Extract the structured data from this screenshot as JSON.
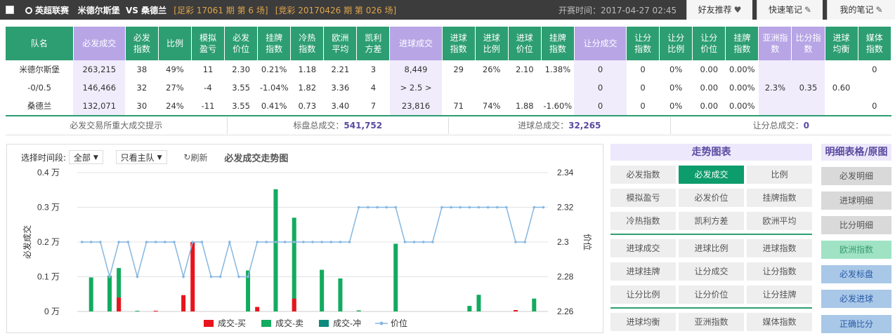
{
  "header": {
    "league": "英超联赛",
    "home": "米德尔斯堡",
    "vs": "VS",
    "away": "桑德兰",
    "issue1": "[足彩 17061 期 第 6 场]",
    "issue2": "[竞彩 20170426 期 第 026 场]",
    "kickoff": "开赛时间：2017-04-27 02:45",
    "btn_friend": "好友推荐",
    "btn_note": "快速笔记",
    "btn_mynote": "我的笔记"
  },
  "table": {
    "headers": [
      "队名",
      "必发成交",
      "必发指数",
      "比例",
      "模拟盈亏",
      "必发价位",
      "挂牌指数",
      "冷热指数",
      "欧洲平均",
      "凯利方差",
      "进球成交",
      "进球指数",
      "进球比例",
      "进球价位",
      "挂牌指数",
      "让分成交",
      "让分指数",
      "让分比例",
      "让分价位",
      "挂牌指数",
      "亚洲指数",
      "比分指数",
      "进球均衡",
      "媒体指数"
    ],
    "rows": [
      [
        "米德尔斯堡",
        "263,215",
        "38",
        "49%",
        "11",
        "2.30",
        "0.21%",
        "1.18",
        "2.21",
        "3",
        "8,449",
        "29",
        "26%",
        "2.10",
        "1.38%",
        "0",
        "0",
        "0%",
        "0.00",
        "0.00%",
        "",
        "",
        "",
        "0"
      ],
      [
        "-0/0.5",
        "146,466",
        "32",
        "27%",
        "-4",
        "3.55",
        "-1.04%",
        "1.82",
        "3.36",
        "4",
        "> 2.5 >",
        "",
        "",
        "",
        "",
        "0",
        "0",
        "0%",
        "0.00",
        "0.00%",
        "2.3%",
        "0.35",
        "0.60",
        ""
      ],
      [
        "桑德兰",
        "132,071",
        "30",
        "24%",
        "-11",
        "3.55",
        "0.41%",
        "0.73",
        "3.40",
        "7",
        "23,816",
        "71",
        "74%",
        "1.88",
        "-1.60%",
        "0",
        "0",
        "0%",
        "0.00",
        "0.00%",
        "",
        "",
        "",
        "0"
      ]
    ]
  },
  "totals": {
    "hint": "必发交易所重大成交提示",
    "main_label": "标盘总成交：",
    "main_value": "541,752",
    "goal_label": "进球总成交：",
    "goal_value": "32,265",
    "handicap_label": "让分总成交：",
    "handicap_value": "0"
  },
  "controls": {
    "period_label": "选择时间段:",
    "period_value": "全部",
    "team_filter": "只看主队",
    "refresh": "刷新",
    "chart_title": "必发成交走势图"
  },
  "chart_data": {
    "type": "bar",
    "ylabel": "必发成交",
    "y2label": "价位",
    "yticks": [
      "0 万",
      "0.1 万",
      "0.2 万",
      "0.3 万",
      "0.4 万"
    ],
    "y2ticks": [
      "2.26",
      "2.28",
      "2.3",
      "2.32",
      "2.34"
    ],
    "ylim": [
      0,
      0.4
    ],
    "y2lim": [
      2.26,
      2.34
    ],
    "n": 51,
    "series": [
      {
        "name": "成交-买",
        "color": "#e8141d",
        "values": [
          0,
          0,
          0,
          0,
          0.04,
          0,
          0,
          0,
          0.002,
          0,
          0,
          0.047,
          0.2,
          0,
          0,
          0,
          0,
          0,
          0,
          0.013,
          0,
          0,
          0,
          0.037,
          0,
          0,
          0,
          0,
          0,
          0,
          0,
          0,
          0,
          0,
          0,
          0,
          0,
          0,
          0,
          0,
          0,
          0,
          0,
          0,
          0,
          0,
          0,
          0.004,
          0,
          0,
          0
        ]
      },
      {
        "name": "成交-卖",
        "color": "#13ab5f",
        "values": [
          0,
          0.098,
          0,
          0.103,
          0.125,
          0,
          0.002,
          0,
          0,
          0,
          0,
          0,
          0,
          0,
          0,
          0,
          0,
          0,
          0.118,
          0,
          0,
          0.352,
          0,
          0.27,
          0,
          0,
          0.12,
          0,
          0.095,
          0,
          0.003,
          0,
          0,
          0,
          0.195,
          0,
          0,
          0,
          0,
          0,
          0,
          0,
          0.016,
          0.048,
          0,
          0,
          0,
          0,
          0,
          0.037,
          0
        ]
      },
      {
        "name": "成交-冲",
        "color": "#0d8a7e",
        "values": []
      },
      {
        "name": "价位",
        "color": "#86b7e0",
        "values": [
          2.3,
          2.3,
          2.3,
          2.28,
          2.3,
          2.3,
          2.28,
          2.3,
          2.3,
          2.3,
          2.3,
          2.28,
          2.3,
          2.3,
          2.28,
          2.28,
          2.3,
          2.28,
          2.28,
          2.3,
          2.3,
          2.3,
          2.3,
          2.3,
          2.3,
          2.3,
          2.3,
          2.3,
          2.3,
          2.3,
          2.32,
          2.32,
          2.32,
          2.32,
          2.32,
          2.3,
          2.3,
          2.3,
          2.3,
          2.32,
          2.32,
          2.32,
          2.32,
          2.32,
          2.32,
          2.32,
          2.32,
          2.3,
          2.3,
          2.32,
          2.32
        ]
      }
    ]
  },
  "right_panel": {
    "title": "走势图表",
    "groups": [
      [
        "必发指数",
        "必发成交",
        "比例",
        "模拟盈亏",
        "必发价位",
        "挂牌指数",
        "冷热指数",
        "凯利方差",
        "欧洲平均"
      ],
      [
        "进球成交",
        "进球比例",
        "进球指数",
        "进球挂牌",
        "让分成交",
        "让分指数",
        "让分比例",
        "让分价位",
        "让分挂牌"
      ],
      [
        "进球均衡",
        "亚洲指数",
        "媒体指数"
      ]
    ],
    "active": "必发成交"
  },
  "side_panel": {
    "title": "明细表格/原图",
    "items": [
      "必发明细",
      "进球明细",
      "比分明细",
      "欧洲指数",
      "必发标盘",
      "必发进球",
      "正确比分"
    ]
  },
  "colors": {
    "green": "#2d9e72",
    "purple": "#b7a5e6",
    "buy": "#e8141d",
    "sell": "#13ab5f",
    "price": "#86b7e0"
  }
}
